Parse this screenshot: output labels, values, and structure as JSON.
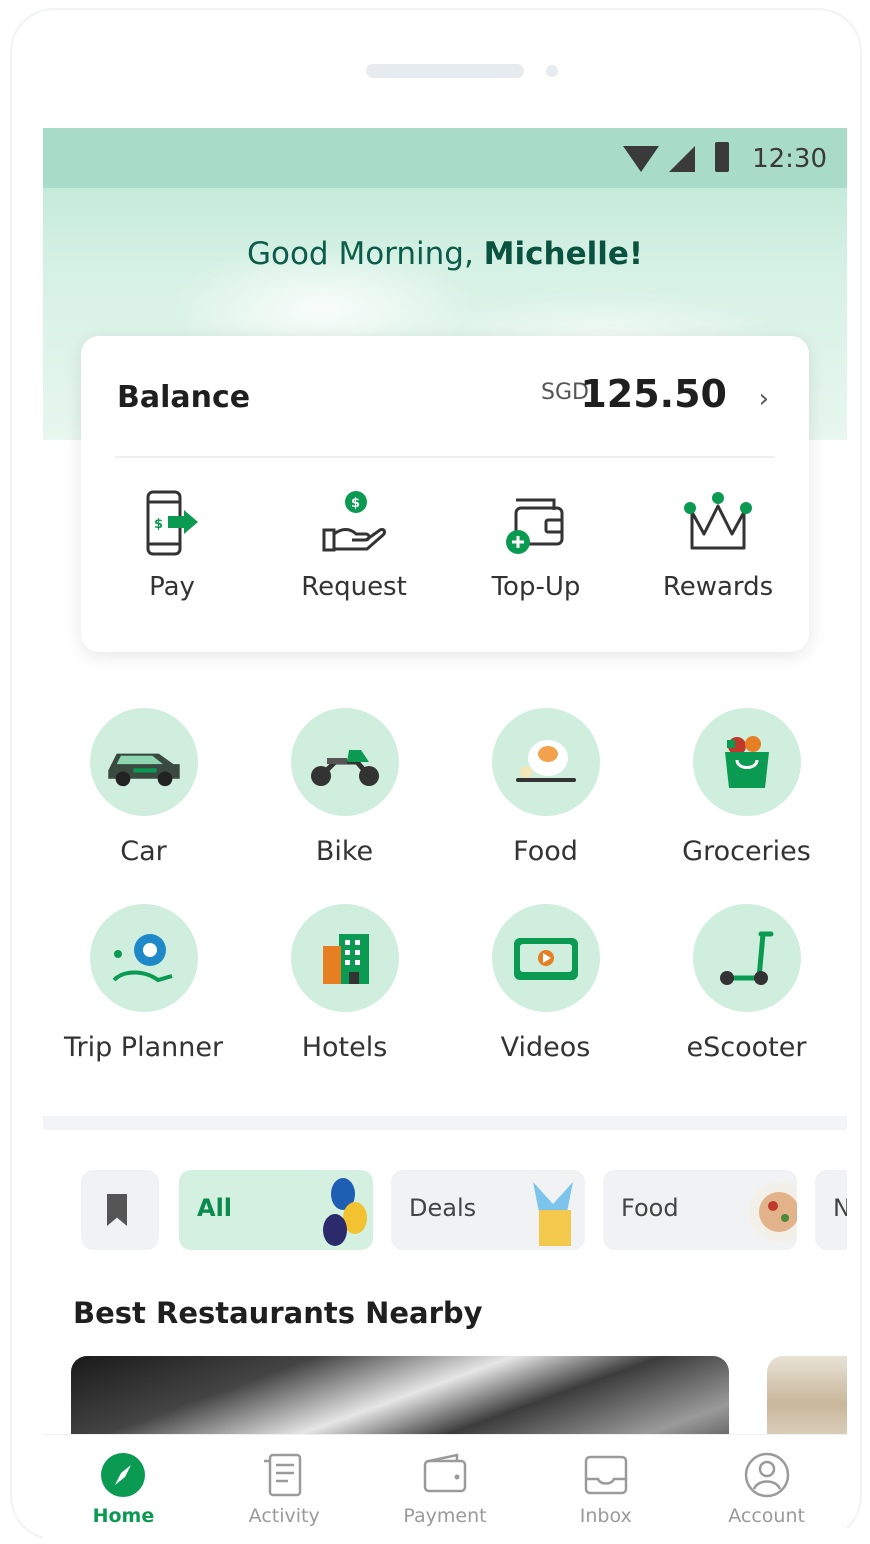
{
  "status_bar": {
    "time": "12:30"
  },
  "greeting": {
    "prefix": "Good Morning,",
    "name": "Michelle!"
  },
  "balance": {
    "label": "Balance",
    "currency": "SGD",
    "amount": "125.50"
  },
  "actions": [
    {
      "label": "Pay",
      "icon": "phone-pay-icon"
    },
    {
      "label": "Request",
      "icon": "hand-coin-icon"
    },
    {
      "label": "Top-Up",
      "icon": "wallet-plus-icon"
    },
    {
      "label": "Rewards",
      "icon": "crown-icon"
    }
  ],
  "services": [
    {
      "label": "Car",
      "icon": "car-icon"
    },
    {
      "label": "Bike",
      "icon": "bike-icon"
    },
    {
      "label": "Food",
      "icon": "food-icon"
    },
    {
      "label": "Groceries",
      "icon": "grocery-bag-icon"
    },
    {
      "label": "Trip Planner",
      "icon": "trip-planner-icon"
    },
    {
      "label": "Hotels",
      "icon": "hotel-icon"
    },
    {
      "label": "Videos",
      "icon": "video-icon"
    },
    {
      "label": "eScooter",
      "icon": "scooter-icon"
    }
  ],
  "chips": [
    {
      "label": "All",
      "active": true
    },
    {
      "label": "Deals",
      "active": false
    },
    {
      "label": "Food",
      "active": false
    },
    {
      "label": "Ne",
      "active": false
    }
  ],
  "section": {
    "title": "Best Restaurants Nearby"
  },
  "bottom_nav": [
    {
      "label": "Home",
      "icon": "compass-icon",
      "active": true
    },
    {
      "label": "Activity",
      "icon": "receipt-icon",
      "active": false
    },
    {
      "label": "Payment",
      "icon": "wallet-icon",
      "active": false
    },
    {
      "label": "Inbox",
      "icon": "inbox-icon",
      "active": false
    },
    {
      "label": "Account",
      "icon": "user-icon",
      "active": false
    }
  ],
  "colors": {
    "brand_green": "#0b9a52",
    "light_green": "#cfeedd",
    "dark_teal": "#0d5c4a"
  }
}
